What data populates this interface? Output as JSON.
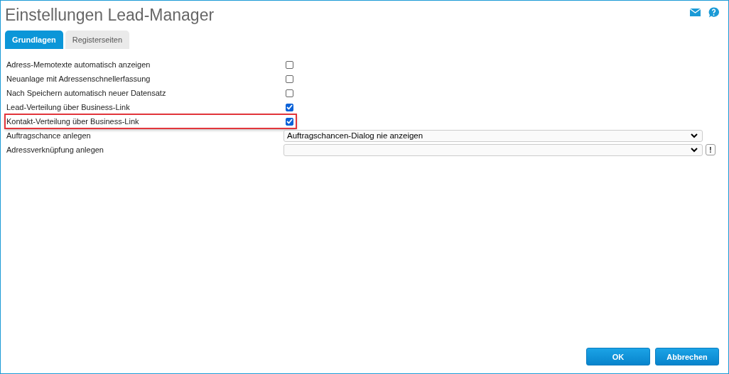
{
  "window": {
    "title": "Einstellungen Lead-Manager"
  },
  "tabs": [
    {
      "label": "Grundlagen",
      "selected": true
    },
    {
      "label": "Registerseiten",
      "selected": false
    }
  ],
  "settings": [
    {
      "kind": "checkbox",
      "label": "Adress-Memotexte automatisch anzeigen",
      "checked": false,
      "highlighted": false
    },
    {
      "kind": "checkbox",
      "label": "Neuanlage mit Adressenschnellerfassung",
      "checked": false,
      "highlighted": false
    },
    {
      "kind": "checkbox",
      "label": "Nach Speichern automatisch neuer Datensatz",
      "checked": false,
      "highlighted": false
    },
    {
      "kind": "checkbox",
      "label": "Lead-Verteilung über Business-Link",
      "checked": true,
      "highlighted": false
    },
    {
      "kind": "checkbox",
      "label": "Kontakt-Verteilung über Business-Link",
      "checked": true,
      "highlighted": true
    },
    {
      "kind": "select",
      "label": "Auftragschance anlegen",
      "value": "Auftragschancen-Dialog nie anzeigen",
      "highlighted": false
    },
    {
      "kind": "select",
      "label": "Adressverknüpfung anlegen",
      "extra_button": "!",
      "highlighted": false
    }
  ],
  "buttons": [
    "OK",
    "Abbrechen"
  ]
}
